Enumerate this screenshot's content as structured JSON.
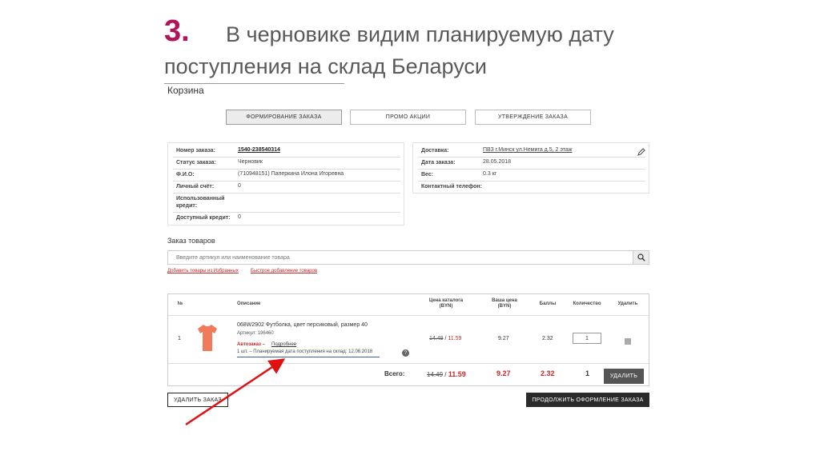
{
  "slide": {
    "number": "3.",
    "title_line1": "В черновике видим планируемую дату",
    "title_line2": "поступления на склад Беларуси"
  },
  "cart": {
    "title": "Корзина",
    "steps": [
      {
        "label": "ФОРМИРОВАНИЕ ЗАКАЗА",
        "active": true
      },
      {
        "label": "ПРОМО АКЦИИ",
        "active": false
      },
      {
        "label": "УТВЕРЖДЕНИЕ ЗАКАЗА",
        "active": false
      }
    ],
    "order_info": [
      {
        "label": "Номер заказа:",
        "value": "1540-238540314"
      },
      {
        "label": "Статус заказа:",
        "value": "Черновик"
      },
      {
        "label": "Ф.И.О:",
        "value": "(710948151) Паперкина Илона Игоревна"
      },
      {
        "label": "Личный счёт:",
        "value": "0"
      },
      {
        "label_line1": "Использованный",
        "label_line2": "кредит:",
        "value": ""
      },
      {
        "label": "Доступный кредит:",
        "value": "0"
      }
    ],
    "delivery_info": [
      {
        "label": "Доставка:",
        "value": "ПВЗ г.Минск ул.Немига д.5, 2 этаж"
      },
      {
        "label": "Дата заказа:",
        "value": "28.05.2018"
      },
      {
        "label": "Вес:",
        "value": "0.3 кг"
      },
      {
        "label": "Контактный телефон:",
        "value": ""
      }
    ]
  },
  "goods": {
    "title": "Заказ товаров",
    "search_placeholder": "Введите артикул или наименование товара",
    "link_favorites": "Добавить товары из Избранных",
    "link_quick_add": "Быстрое добавление товаров"
  },
  "table": {
    "headers": {
      "num": "№",
      "description": "Описание",
      "catalog_price_line1": "Цена каталога",
      "catalog_price_line2": "(BYN)",
      "your_price_line1": "Ваша цена",
      "your_price_line2": "(BYN)",
      "points": "Баллы",
      "quantity": "Количество",
      "delete": "Удалить"
    },
    "row": {
      "num": "1",
      "name": "068W2902 Футболка, цвет персиковый, размер 40",
      "article": "Артикул: 196460",
      "autoorder": "Автозаказ –",
      "details_link": "Подробнее",
      "planned_date": "1 шт. – Планируемая дата поступления на склад: 12.06.2018",
      "old_price": "14.49",
      "slash": "/",
      "new_price": "11.59",
      "your_price": "9.27",
      "points": "2.32",
      "qty": "1",
      "help": "?"
    },
    "total": {
      "label": "Всего:",
      "old_price": "14.49",
      "slash": "/",
      "new_price": "11.59",
      "your_price": "9.27",
      "points": "2.32",
      "qty": "1",
      "delete_btn": "УДАЛИТЬ"
    }
  },
  "actions": {
    "delete_order": "УДАЛИТЬ ЗАКАЗ",
    "continue": "ПРОДОЛЖИТЬ ОФОРМЛЕНИЕ ЗАКАЗА"
  },
  "colors": {
    "accent_number": "#b0145a",
    "price_red": "#c62828",
    "arrow_red": "#e01010",
    "tshirt": "#f07a5a"
  }
}
